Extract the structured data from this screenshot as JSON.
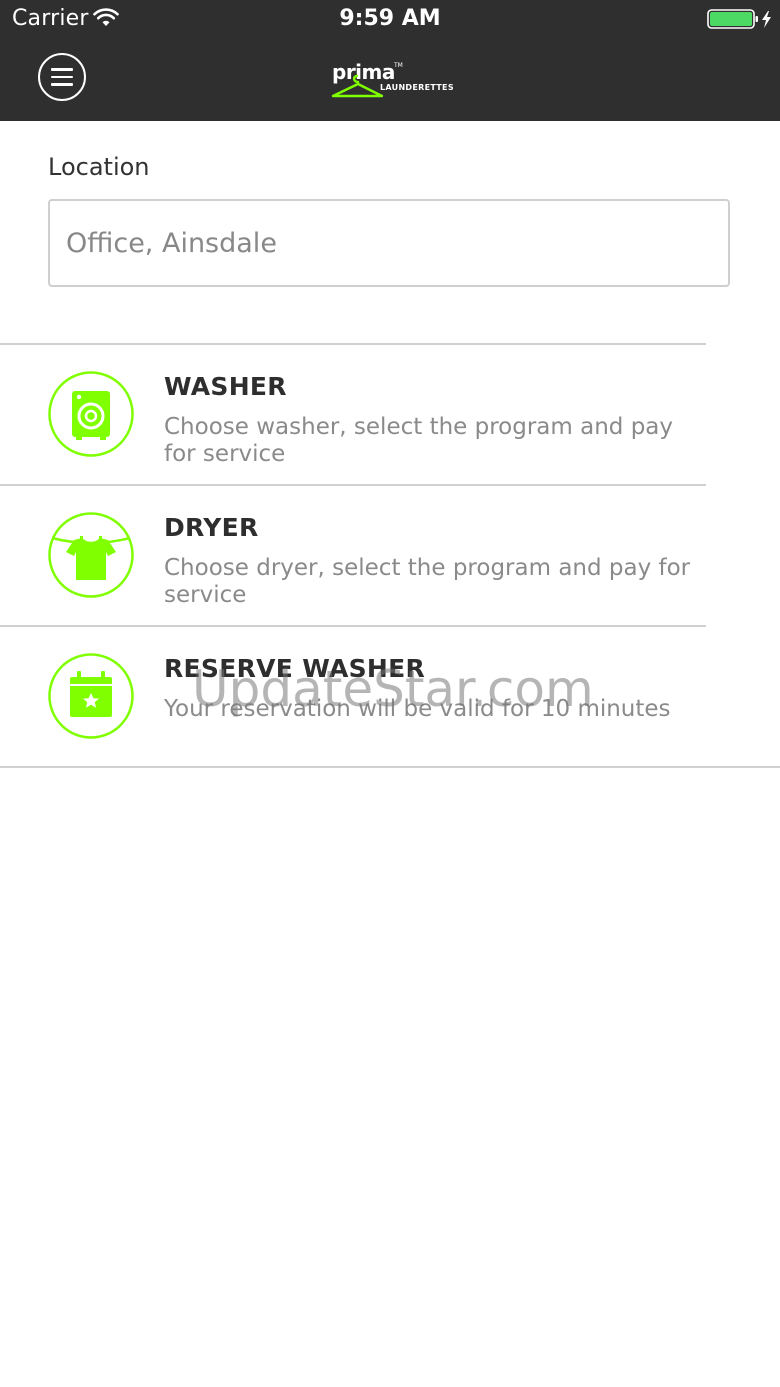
{
  "status_bar": {
    "carrier": "Carrier",
    "time": "9:59 AM",
    "wifi_icon": "wifi-icon",
    "battery_icon": "battery-icon",
    "battery_color": "#4cd964"
  },
  "nav": {
    "menu_icon": "hamburger-menu-icon",
    "logo": {
      "name": "prima",
      "tm": "TM",
      "sub": "LAUNDERETTES"
    }
  },
  "location": {
    "label": "Location",
    "value": "Office, Ainsdale"
  },
  "menu": {
    "items": [
      {
        "title": "WASHER",
        "description": "Choose washer, select the program and pay for service",
        "icon": "washing-machine-icon"
      },
      {
        "title": "DRYER",
        "description": "Choose dryer, select the program and pay for service",
        "icon": "tshirt-clothesline-icon"
      },
      {
        "title": "RESERVE WASHER",
        "description": "Your reservation will be valid for 10 minutes",
        "icon": "calendar-star-icon"
      }
    ]
  },
  "watermark": "UpdateStar.com",
  "colors": {
    "header_bg": "#2f2f2f",
    "accent_green": "#7fff00"
  }
}
